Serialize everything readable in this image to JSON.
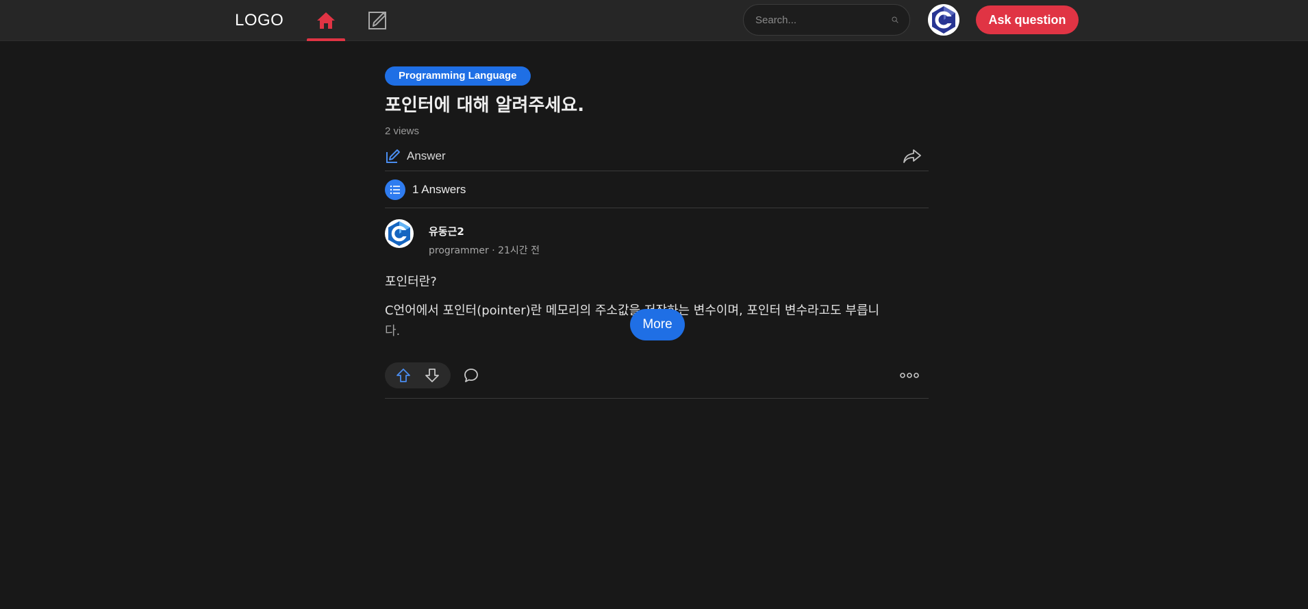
{
  "header": {
    "logo": "LOGO",
    "search_placeholder": "Search...",
    "ask_button": "Ask question",
    "active_color": "#e03444"
  },
  "question": {
    "category": "Programming Language",
    "title": "포인터에 대해 알려주세요.",
    "views": "2 views",
    "answer_label": "Answer"
  },
  "answers": {
    "count_label": "1 Answers",
    "items": [
      {
        "author": "유동근2",
        "meta": "programmer · 21시간 전",
        "paragraph1": "포인터란?",
        "paragraph2_line1": "C언어에서 포인터(pointer)란 메모리의 주소값을 저장하는 변수이며, 포인터 변수라고도 부릅니",
        "paragraph2_line2": "다.",
        "more_button": "More"
      }
    ]
  },
  "colors": {
    "accent_blue": "#1f6fe5",
    "accent_red": "#e03444",
    "background": "#181818",
    "topbar": "#262626"
  },
  "icons": {
    "home": "home-icon",
    "write": "edit-square-icon",
    "search": "search-icon",
    "share": "share-icon",
    "list": "list-icon",
    "upvote": "arrow-up-icon",
    "downvote": "arrow-down-icon",
    "comment": "comment-icon",
    "more": "more-horizontal-icon"
  }
}
